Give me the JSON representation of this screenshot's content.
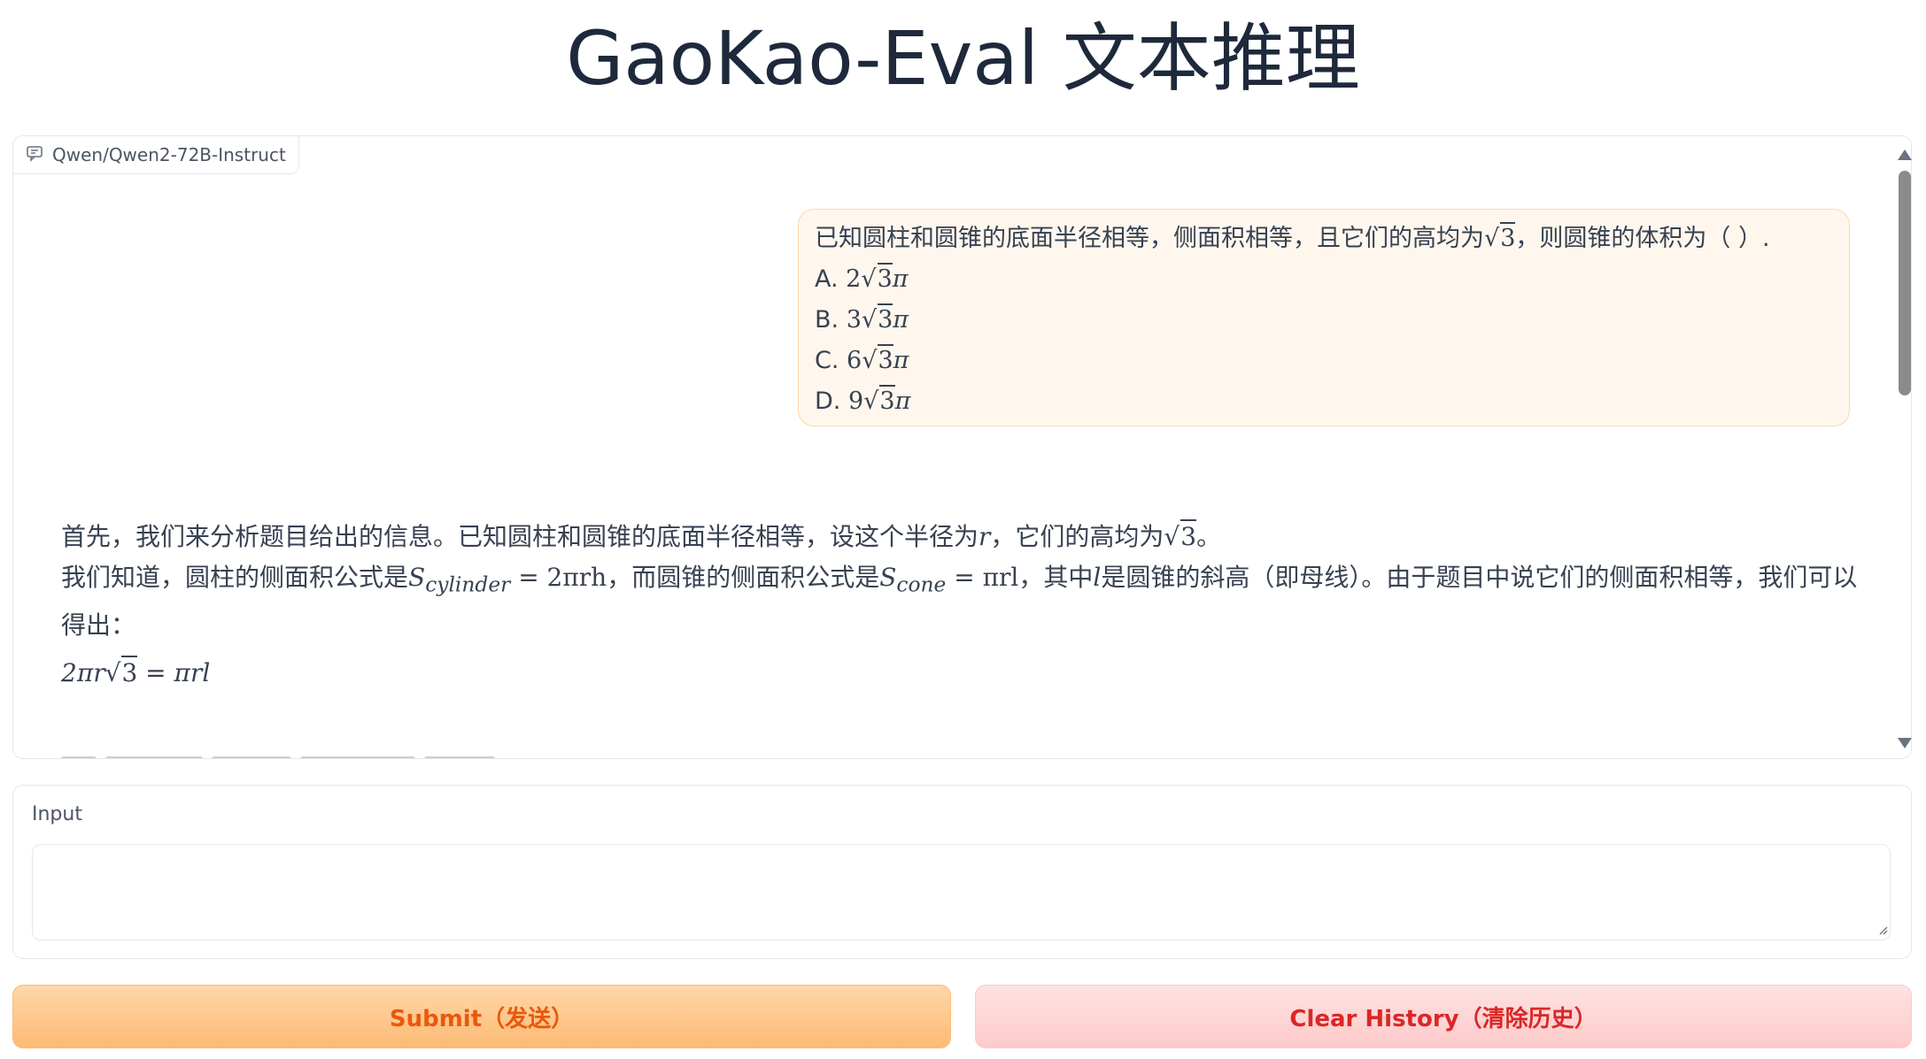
{
  "page": {
    "title": "GaoKao-Eval 文本推理"
  },
  "chat": {
    "label": "Qwen/Qwen2-72B-Instruct",
    "user_message": {
      "question_prefix": "已知圆柱和圆锥的底面半径相等，侧面积相等，且它们的高均为",
      "question_sqrt": "3",
      "question_suffix": "，则圆锥的体积为（ ）.",
      "options": [
        {
          "label": "A.",
          "coef": "2",
          "sqrt": "3",
          "tail": "π"
        },
        {
          "label": "B.",
          "coef": "3",
          "sqrt": "3",
          "tail": "π"
        },
        {
          "label": "C.",
          "coef": "6",
          "sqrt": "3",
          "tail": "π"
        },
        {
          "label": "D.",
          "coef": "9",
          "sqrt": "3",
          "tail": "π"
        }
      ]
    },
    "bot_message": {
      "line1_a": "首先，我们来分析题目给出的信息。已知圆柱和圆锥的底面半径相等，设这个半径为",
      "line1_var": "r",
      "line1_b": "，它们的高均为",
      "line1_sqrt": "3",
      "line1_c": "。",
      "line2_a": "我们知道，圆柱的侧面积公式是",
      "line2_f1_s": "S",
      "line2_f1_sub": "cylinder",
      "line2_f1_rest": " = 2πrh",
      "line2_b": "，而圆锥的侧面积公式是",
      "line2_f2_s": "S",
      "line2_f2_sub": "cone",
      "line2_f2_rest": " = πrl",
      "line2_c": "，其中",
      "line2_var": "l",
      "line2_d": "是圆锥的斜高（即母线）。由于题目中说它们的侧面积相等，我们可以",
      "line3": "得出：",
      "equation_left": "2πr",
      "equation_sqrt": "3",
      "equation_right": " = πrl"
    }
  },
  "input": {
    "label": "Input",
    "value": "",
    "placeholder": ""
  },
  "buttons": {
    "submit": "Submit（发送）",
    "clear": "Clear History（清除历史）"
  },
  "colors": {
    "submit_text": "#ea580c",
    "clear_text": "#dc2626",
    "user_bubble": "#fff7ee"
  }
}
